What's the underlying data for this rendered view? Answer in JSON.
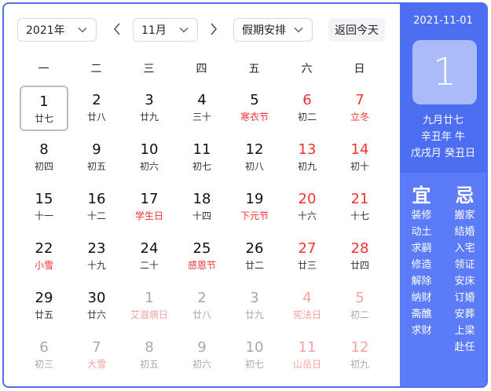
{
  "controls": {
    "year": "2021年",
    "month": "11月",
    "holiday": "假期安排",
    "today_btn": "返回今天"
  },
  "weekdays": [
    "一",
    "二",
    "三",
    "四",
    "五",
    "六",
    "日"
  ],
  "days": [
    {
      "d": "1",
      "l": "廿七",
      "fest": false,
      "today": true
    },
    {
      "d": "2",
      "l": "廿八"
    },
    {
      "d": "3",
      "l": "廿九"
    },
    {
      "d": "4",
      "l": "三十"
    },
    {
      "d": "5",
      "l": "寒衣节",
      "fest": true
    },
    {
      "d": "6",
      "l": "初二",
      "we": true
    },
    {
      "d": "7",
      "l": "立冬",
      "we": true,
      "fest": true
    },
    {
      "d": "8",
      "l": "初四"
    },
    {
      "d": "9",
      "l": "初五"
    },
    {
      "d": "10",
      "l": "初六"
    },
    {
      "d": "11",
      "l": "初七"
    },
    {
      "d": "12",
      "l": "初八"
    },
    {
      "d": "13",
      "l": "初九",
      "we": true
    },
    {
      "d": "14",
      "l": "初十",
      "we": true
    },
    {
      "d": "15",
      "l": "十一"
    },
    {
      "d": "16",
      "l": "十二"
    },
    {
      "d": "17",
      "l": "学生日",
      "fest": true
    },
    {
      "d": "18",
      "l": "十四"
    },
    {
      "d": "19",
      "l": "下元节",
      "fest": true
    },
    {
      "d": "20",
      "l": "十六",
      "we": true
    },
    {
      "d": "21",
      "l": "十七",
      "we": true
    },
    {
      "d": "22",
      "l": "小雪",
      "fest": true
    },
    {
      "d": "23",
      "l": "十九"
    },
    {
      "d": "24",
      "l": "二十"
    },
    {
      "d": "25",
      "l": "感恩节",
      "fest": true
    },
    {
      "d": "26",
      "l": "廿二"
    },
    {
      "d": "27",
      "l": "廿三",
      "we": true
    },
    {
      "d": "28",
      "l": "廿四",
      "we": true
    },
    {
      "d": "29",
      "l": "廿五"
    },
    {
      "d": "30",
      "l": "廿六"
    },
    {
      "d": "1",
      "l": "艾滋病日",
      "other": true,
      "fest": true
    },
    {
      "d": "2",
      "l": "廿八",
      "other": true
    },
    {
      "d": "3",
      "l": "廿九",
      "other": true
    },
    {
      "d": "4",
      "l": "宪法日",
      "other": true,
      "we": true,
      "fest": true
    },
    {
      "d": "5",
      "l": "初二",
      "other": true,
      "we": true
    },
    {
      "d": "6",
      "l": "初三",
      "other": true
    },
    {
      "d": "7",
      "l": "大雪",
      "other": true,
      "fest": true
    },
    {
      "d": "8",
      "l": "初五",
      "other": true
    },
    {
      "d": "9",
      "l": "初六",
      "other": true
    },
    {
      "d": "10",
      "l": "初七",
      "other": true
    },
    {
      "d": "11",
      "l": "山岳日",
      "other": true,
      "we": true,
      "fest": true
    },
    {
      "d": "12",
      "l": "初九",
      "other": true,
      "we": true
    }
  ],
  "panel": {
    "date": "2021-11-01",
    "big_day": "1",
    "lunar": "九月廿七",
    "year_gz": "辛丑年 牛",
    "month_day_gz": "戊戌月 癸丑日",
    "yi_title": "宜",
    "ji_title": "忌",
    "yi": [
      "装修",
      "动土",
      "求嗣",
      "修造",
      "解除",
      "纳财",
      "斋醮",
      "求财"
    ],
    "ji": [
      "搬家",
      "结婚",
      "入宅",
      "领证",
      "安床",
      "订婚",
      "安葬",
      "上梁",
      "赴任"
    ]
  },
  "colors": {
    "accent": "#4e6ef2",
    "holiday_red": "#f73131"
  }
}
